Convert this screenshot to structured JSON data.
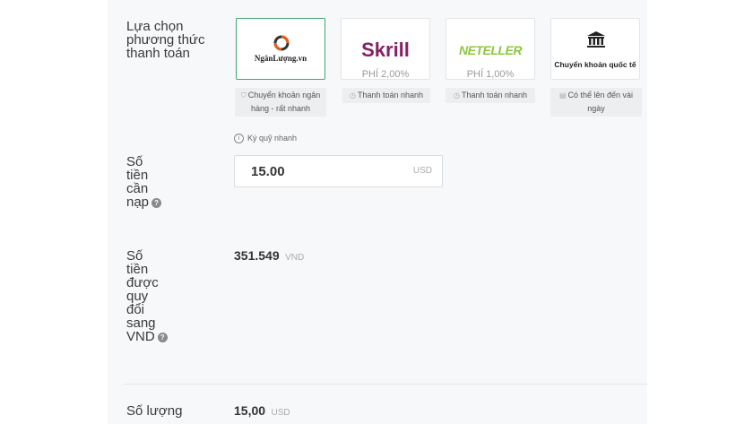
{
  "labels": {
    "payment_method": [
      "Lựa chọn",
      "phương thức",
      "thanh toán"
    ],
    "amount": [
      "Số",
      "tiền",
      "cần",
      "nạp"
    ],
    "converted": [
      "Số",
      "tiền",
      "được",
      "quy",
      "đổi",
      "sang",
      "VND"
    ],
    "quantity": "Số lượng"
  },
  "methods": [
    {
      "name": "NgânLượng.vn",
      "fee": "",
      "tag": [
        "Chuyển khoản ngân",
        "hàng - rất nhanh"
      ],
      "selected": true
    },
    {
      "name": "Skrill",
      "fee": "PHÍ 2,00%",
      "tag": [
        "Thanh toán nhanh"
      ],
      "selected": false
    },
    {
      "name": "NETELLER",
      "fee": "PHÍ 1,00%",
      "tag": [
        "Thanh toán nhanh"
      ],
      "selected": false
    },
    {
      "name": "Chuyển khoản quốc tế",
      "fee": "",
      "tag": [
        "Có thể lên đến vài",
        "ngày"
      ],
      "selected": false
    }
  ],
  "deposit_note": "Ký quỹ nhanh",
  "amount_input": {
    "value": "15.00",
    "currency": "USD"
  },
  "converted_value": {
    "value": "351.549",
    "currency": "VND"
  },
  "quantity_value": {
    "value": "15,00",
    "currency": "USD"
  },
  "colors": {
    "skrill": "#862165",
    "neteller": "#8dc63f",
    "selected_border": "#3ea86a",
    "ngan_luong_logo": "#e85c1c"
  },
  "icons": [
    "ngan-luong-logo-icon",
    "bank-icon",
    "shield-icon",
    "clock-icon",
    "info-icon"
  ]
}
